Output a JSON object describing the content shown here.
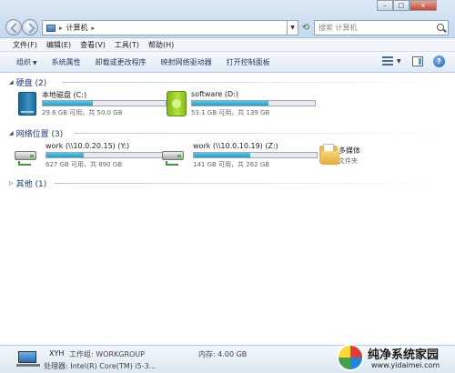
{
  "window": {
    "address": [
      "计算机"
    ],
    "search_placeholder": "搜索 计算机",
    "controls": {
      "minimize": "–",
      "maximize": "□",
      "close": "x"
    }
  },
  "menu": [
    "文件(F)",
    "编辑(E)",
    "查看(V)",
    "工具(T)",
    "帮助(H)"
  ],
  "commands": {
    "organize": "组织",
    "items": [
      "系统属性",
      "卸载或更改程序",
      "映射网络驱动器",
      "打开控制面板"
    ]
  },
  "groups": {
    "hard_disks": {
      "title": "硬盘 (2)",
      "drives": [
        {
          "name": "本地磁盘 (C:)",
          "detail": "29.6 GB 可用，共 50.0 GB",
          "used_fraction": 0.41,
          "icon": "local-disk-icon"
        },
        {
          "name": "software (D:)",
          "detail": "53.1 GB 可用，共 139 GB",
          "used_fraction": 0.62,
          "icon": "usb-drive-icon"
        }
      ]
    },
    "network": {
      "title": "网络位置 (3)",
      "drives": [
        {
          "name": "work (\\\\10.0.20.15) (Y:)",
          "detail": "627 GB 可用，共 890 GB",
          "used_fraction": 0.3,
          "icon": "network-drive-icon"
        },
        {
          "name": "work (\\\\10.0.10.19) (Z:)",
          "detail": "141 GB 可用，共 262 GB",
          "used_fraction": 0.46,
          "icon": "network-drive-icon"
        }
      ],
      "folder": {
        "name": "多媒体",
        "type": "文件夹",
        "icon": "folder-icon"
      }
    },
    "other": {
      "title": "其他 (1)"
    }
  },
  "details": {
    "pc_name": "XYH",
    "workgroup": "工作组: WORKGROUP",
    "memory": "内存: 4.00 GB",
    "processor": "处理器: Intel(R) Core(TM) i5-3..."
  },
  "watermark": {
    "title": "纯净系统家园",
    "url": "www.yidaimei.com"
  }
}
